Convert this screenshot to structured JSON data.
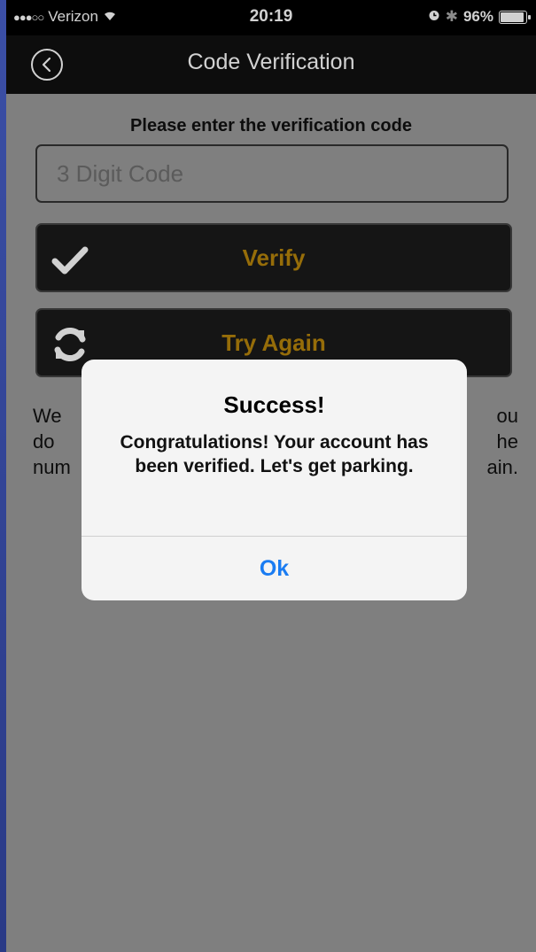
{
  "status_bar": {
    "carrier": "Verizon",
    "time": "20:19",
    "battery": "96%"
  },
  "nav": {
    "title": "Code Verification"
  },
  "form": {
    "prompt": "Please enter the verification code",
    "code_placeholder": "3 Digit Code"
  },
  "buttons": {
    "verify_label": "Verify",
    "retry_label": "Try Again"
  },
  "info_fragments": {
    "line1_left": "We",
    "line1_right": "ou",
    "line2_left": "do",
    "line2_right": "he",
    "line3_left": "num",
    "line3_right": "ain."
  },
  "alert": {
    "title": "Success!",
    "message": "Congratulations! Your account has been verified. Let's get parking.",
    "ok_label": "Ok"
  },
  "colors": {
    "accent_gold": "#b8860b",
    "ios_blue": "#1a7cf2"
  }
}
